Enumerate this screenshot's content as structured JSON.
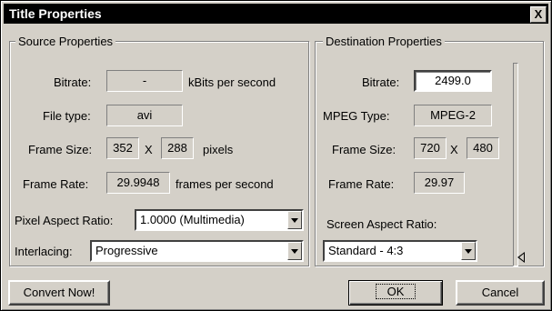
{
  "window": {
    "title": "Title Properties",
    "close_label": "X"
  },
  "source": {
    "legend": "Source Properties",
    "bitrate_label": "Bitrate:",
    "bitrate_value": "-",
    "bitrate_unit": "kBits per second",
    "filetype_label": "File type:",
    "filetype_value": "avi",
    "framesize_label": "Frame Size:",
    "framesize_w": "352",
    "framesize_x": "X",
    "framesize_h": "288",
    "framesize_unit": "pixels",
    "framerate_label": "Frame Rate:",
    "framerate_value": "29.9948",
    "framerate_unit": "frames per second",
    "par_label": "Pixel Aspect Ratio:",
    "par_value": "1.0000 (Multimedia)",
    "interlacing_label": "Interlacing:",
    "interlacing_value": "Progressive"
  },
  "destination": {
    "legend": "Destination Properties",
    "bitrate_label": "Bitrate:",
    "bitrate_value": "2499.0",
    "mpeg_label": "MPEG Type:",
    "mpeg_value": "MPEG-2",
    "framesize_label": "Frame Size:",
    "framesize_w": "720",
    "framesize_x": "X",
    "framesize_h": "480",
    "framerate_label": "Frame Rate:",
    "framerate_value": "29.97",
    "sar_label": "Screen Aspect Ratio:",
    "sar_value": "Standard - 4:3"
  },
  "buttons": {
    "convert": "Convert Now!",
    "ok": "OK",
    "cancel": "Cancel"
  }
}
